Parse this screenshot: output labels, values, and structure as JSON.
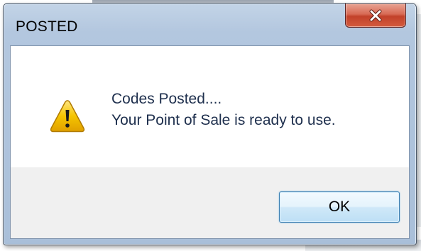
{
  "window": {
    "title": "POSTED"
  },
  "message": {
    "line1": "Codes Posted....",
    "line2": "Your Point of Sale is ready to use."
  },
  "buttons": {
    "ok_label": "OK"
  },
  "icons": {
    "dialog_icon": "warning-icon",
    "close": "close-icon"
  },
  "colors": {
    "close_button": "#c2412a",
    "warning_fill": "#f5c400",
    "message_text": "#1e2f4d",
    "ok_border": "#3c7fb1"
  }
}
